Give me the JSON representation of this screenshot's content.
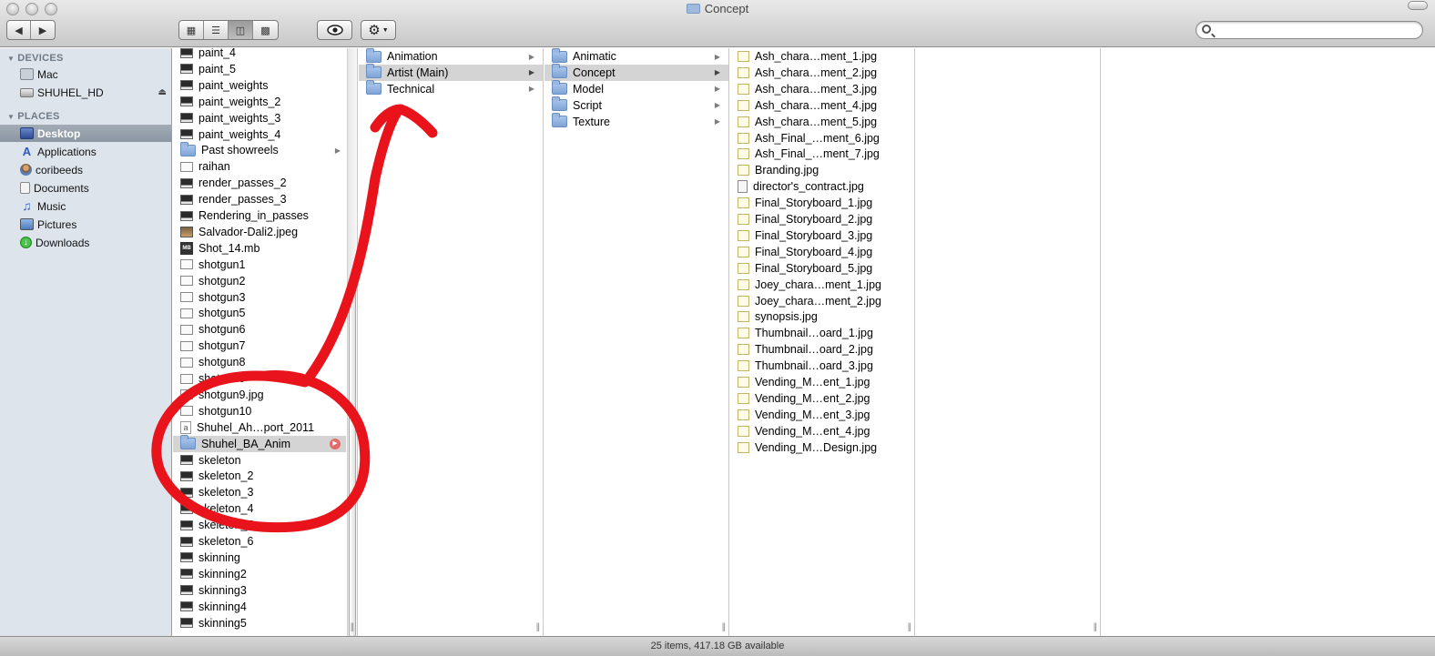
{
  "window": {
    "title": "Concept"
  },
  "toolbar": {
    "back_icon": "back-arrow-icon",
    "forward_icon": "forward-arrow-icon",
    "view_modes": [
      "icon-view",
      "list-view",
      "column-view",
      "coverflow-view"
    ],
    "active_view": "column-view",
    "quicklook_icon": "eye-icon",
    "action_icon": "gear-icon"
  },
  "search": {
    "value": "",
    "placeholder": ""
  },
  "sidebar": {
    "devices_header": "DEVICES",
    "places_header": "PLACES",
    "devices": [
      {
        "label": "Mac",
        "icon": "computer-icon"
      },
      {
        "label": "SHUHEL_HD",
        "icon": "hard-drive-icon"
      }
    ],
    "places": [
      {
        "label": "Desktop",
        "icon": "desktop-icon",
        "selected": true
      },
      {
        "label": "Applications",
        "icon": "applications-icon"
      },
      {
        "label": "coribeeds",
        "icon": "home-icon"
      },
      {
        "label": "Documents",
        "icon": "documents-icon"
      },
      {
        "label": "Music",
        "icon": "music-icon"
      },
      {
        "label": "Pictures",
        "icon": "pictures-icon"
      },
      {
        "label": "Downloads",
        "icon": "downloads-icon"
      }
    ]
  },
  "columns": [
    {
      "items": [
        {
          "name": "paint_4",
          "kind": "file"
        },
        {
          "name": "paint_5",
          "kind": "file"
        },
        {
          "name": "paint_weights",
          "kind": "file"
        },
        {
          "name": "paint_weights_2",
          "kind": "file"
        },
        {
          "name": "paint_weights_3",
          "kind": "file"
        },
        {
          "name": "paint_weights_4",
          "kind": "file"
        },
        {
          "name": "Past showreels",
          "kind": "folder"
        },
        {
          "name": "raihan",
          "kind": "plain"
        },
        {
          "name": "render_passes_2",
          "kind": "file"
        },
        {
          "name": "render_passes_3",
          "kind": "file"
        },
        {
          "name": "Rendering_in_passes",
          "kind": "file"
        },
        {
          "name": "Salvador-Dali2.jpeg",
          "kind": "jpeg"
        },
        {
          "name": "Shot_14.mb",
          "kind": "mb"
        },
        {
          "name": "shotgun1",
          "kind": "plain"
        },
        {
          "name": "shotgun2",
          "kind": "plain"
        },
        {
          "name": "shotgun3",
          "kind": "plain"
        },
        {
          "name": "shotgun5",
          "kind": "plain"
        },
        {
          "name": "shotgun6",
          "kind": "plain"
        },
        {
          "name": "shotgun7",
          "kind": "plain"
        },
        {
          "name": "shotgun8",
          "kind": "plain"
        },
        {
          "name": "shotgun9",
          "kind": "plain"
        },
        {
          "name": "shotgun9.jpg",
          "kind": "plain"
        },
        {
          "name": "shotgun10",
          "kind": "plain"
        },
        {
          "name": "Shuhel_Ah…port_2011",
          "kind": "app"
        },
        {
          "name": "Shuhel_BA_Anim",
          "kind": "folder",
          "selected": true
        },
        {
          "name": "skeleton",
          "kind": "file"
        },
        {
          "name": "skeleton_2",
          "kind": "file"
        },
        {
          "name": "skeleton_3",
          "kind": "file"
        },
        {
          "name": "skeleton_4",
          "kind": "file"
        },
        {
          "name": "skeleton_5",
          "kind": "file"
        },
        {
          "name": "skeleton_6",
          "kind": "file"
        },
        {
          "name": "skinning",
          "kind": "file"
        },
        {
          "name": "skinning2",
          "kind": "file"
        },
        {
          "name": "skinning3",
          "kind": "file"
        },
        {
          "name": "skinning4",
          "kind": "file"
        },
        {
          "name": "skinning5",
          "kind": "file"
        }
      ]
    },
    {
      "items": [
        {
          "name": "Animation",
          "kind": "folder"
        },
        {
          "name": "Artist (Main)",
          "kind": "folder",
          "selected": true
        },
        {
          "name": "Technical",
          "kind": "folder"
        }
      ]
    },
    {
      "items": [
        {
          "name": "Animatic",
          "kind": "folder"
        },
        {
          "name": "Concept",
          "kind": "folder",
          "selected": true
        },
        {
          "name": "Model",
          "kind": "folder"
        },
        {
          "name": "Script",
          "kind": "folder"
        },
        {
          "name": "Texture",
          "kind": "folder"
        }
      ]
    },
    {
      "items": [
        {
          "name": "Ash_chara…ment_1.jpg",
          "kind": "img"
        },
        {
          "name": "Ash_chara…ment_2.jpg",
          "kind": "img"
        },
        {
          "name": "Ash_chara…ment_3.jpg",
          "kind": "img"
        },
        {
          "name": "Ash_chara…ment_4.jpg",
          "kind": "img"
        },
        {
          "name": "Ash_chara…ment_5.jpg",
          "kind": "img"
        },
        {
          "name": "Ash_Final_…ment_6.jpg",
          "kind": "img"
        },
        {
          "name": "Ash_Final_…ment_7.jpg",
          "kind": "img"
        },
        {
          "name": "Branding.jpg",
          "kind": "img"
        },
        {
          "name": "director's_contract.jpg",
          "kind": "doc"
        },
        {
          "name": "Final_Storyboard_1.jpg",
          "kind": "img"
        },
        {
          "name": "Final_Storyboard_2.jpg",
          "kind": "img"
        },
        {
          "name": "Final_Storyboard_3.jpg",
          "kind": "img"
        },
        {
          "name": "Final_Storyboard_4.jpg",
          "kind": "img"
        },
        {
          "name": "Final_Storyboard_5.jpg",
          "kind": "img"
        },
        {
          "name": "Joey_chara…ment_1.jpg",
          "kind": "img"
        },
        {
          "name": "Joey_chara…ment_2.jpg",
          "kind": "img"
        },
        {
          "name": "synopsis.jpg",
          "kind": "img"
        },
        {
          "name": "Thumbnail…oard_1.jpg",
          "kind": "img"
        },
        {
          "name": "Thumbnail…oard_2.jpg",
          "kind": "img"
        },
        {
          "name": "Thumbnail…oard_3.jpg",
          "kind": "img"
        },
        {
          "name": "Vending_M…ent_1.jpg",
          "kind": "img"
        },
        {
          "name": "Vending_M…ent_2.jpg",
          "kind": "img"
        },
        {
          "name": "Vending_M…ent_3.jpg",
          "kind": "img"
        },
        {
          "name": "Vending_M…ent_4.jpg",
          "kind": "img"
        },
        {
          "name": "Vending_M…Design.jpg",
          "kind": "img"
        }
      ]
    },
    {
      "items": []
    },
    {
      "items": []
    }
  ],
  "status": {
    "text": "25 items, 417.18 GB available"
  },
  "colors": {
    "annotation": "#e8131b",
    "sidebar_bg": "#dde4eb",
    "selection_gray": "#d4d4d4"
  }
}
